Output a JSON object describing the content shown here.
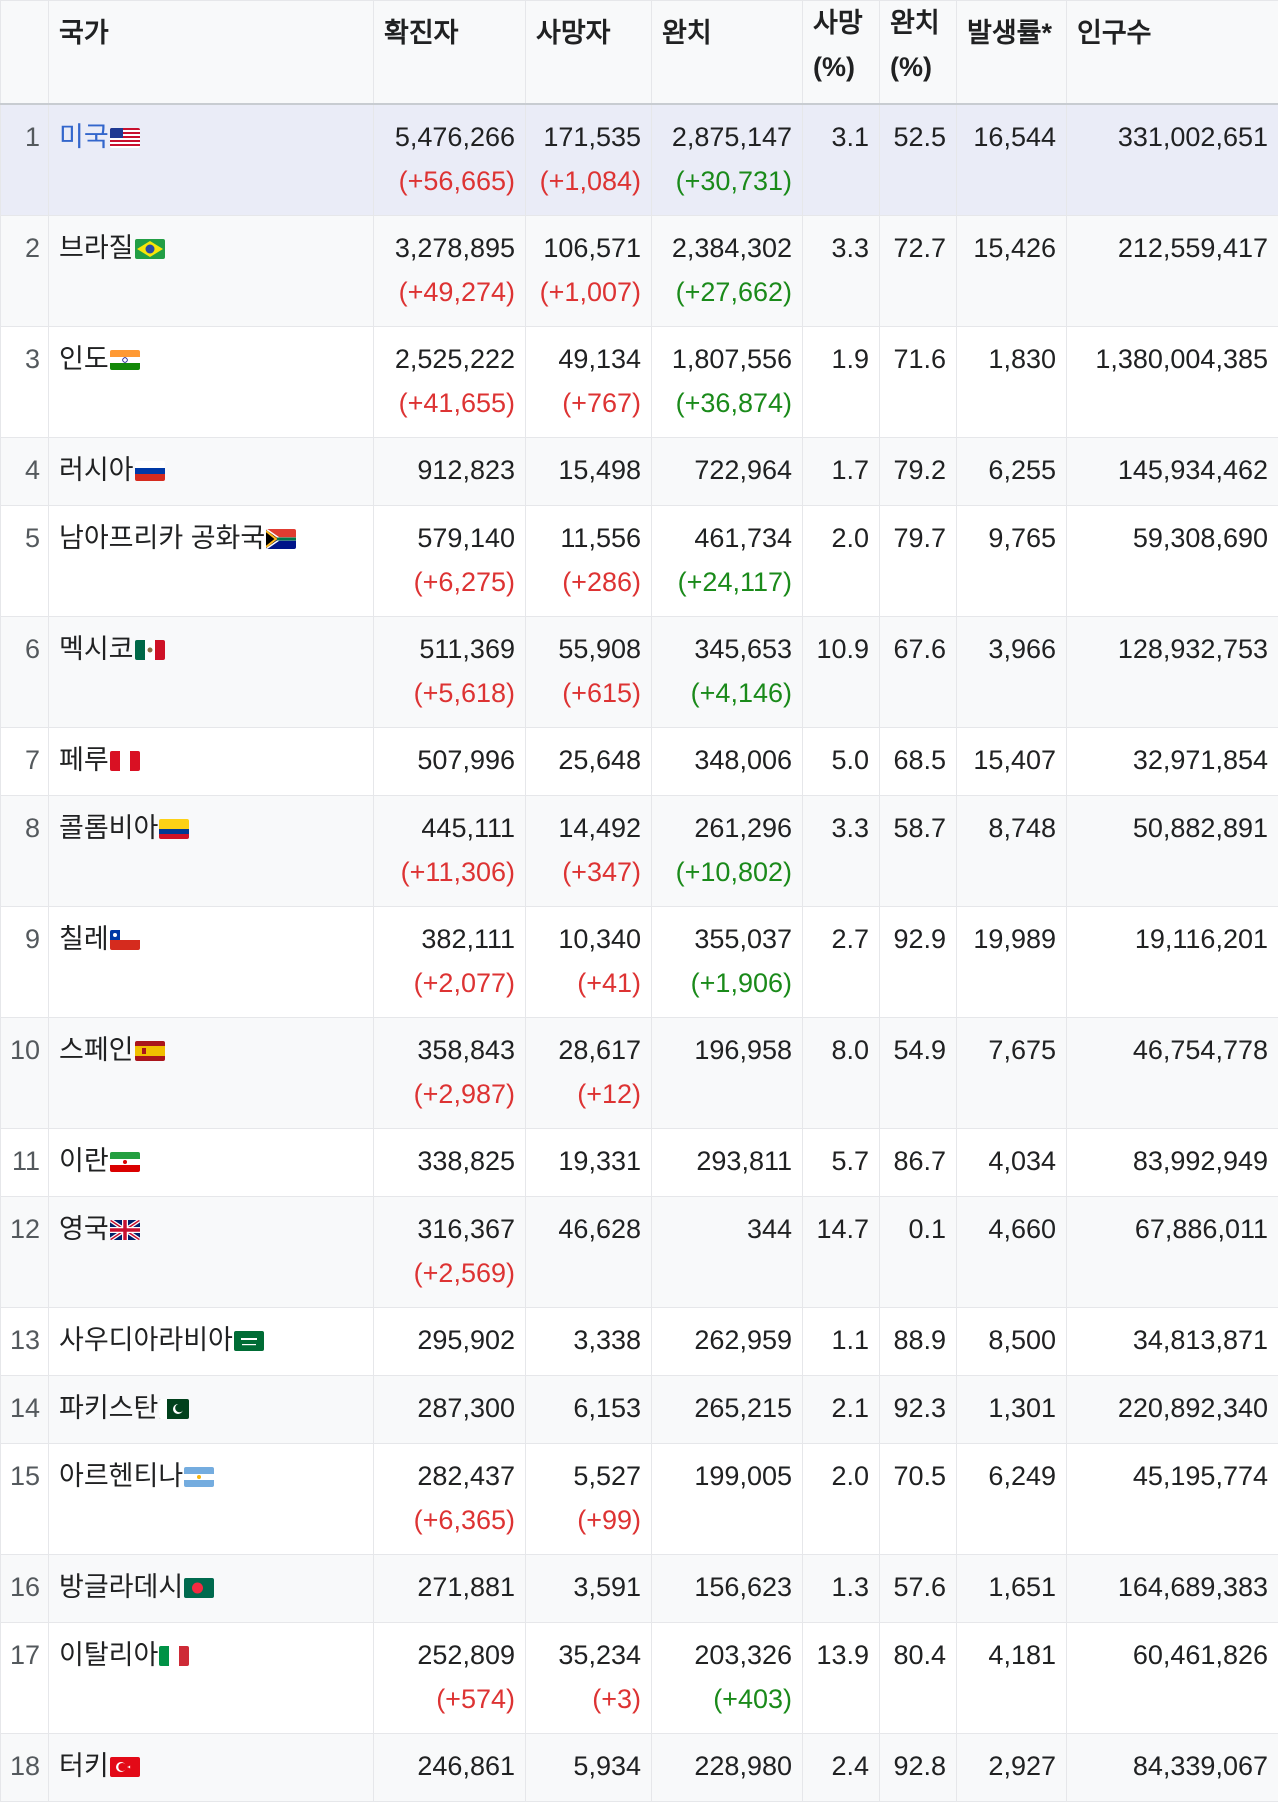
{
  "headers": {
    "rank": "",
    "country": "국가",
    "confirmed": "확진자",
    "deaths": "사망자",
    "recovered": "완치",
    "death_rate_1": "사망",
    "death_rate_2": "(%)",
    "recovery_rate_1": "완치",
    "recovery_rate_2": "(%)",
    "incidence": "발생률*",
    "population": "인구수"
  },
  "rows": [
    {
      "rank": "1",
      "country": "미국",
      "flag": "us-flag-icon",
      "confirmed": "5,476,266",
      "confirmed_delta": "(+56,665)",
      "deaths": "171,535",
      "deaths_delta": "(+1,084)",
      "recovered": "2,875,147",
      "recovered_delta": "(+30,731)",
      "death_rate": "3.1",
      "recovery_rate": "52.5",
      "incidence": "16,544",
      "population": "331,002,651"
    },
    {
      "rank": "2",
      "country": "브라질",
      "flag": "brazil-flag-icon",
      "confirmed": "3,278,895",
      "confirmed_delta": "(+49,274)",
      "deaths": "106,571",
      "deaths_delta": "(+1,007)",
      "recovered": "2,384,302",
      "recovered_delta": "(+27,662)",
      "death_rate": "3.3",
      "recovery_rate": "72.7",
      "incidence": "15,426",
      "population": "212,559,417"
    },
    {
      "rank": "3",
      "country": "인도",
      "flag": "india-flag-icon",
      "confirmed": "2,525,222",
      "confirmed_delta": "(+41,655)",
      "deaths": "49,134",
      "deaths_delta": "(+767)",
      "recovered": "1,807,556",
      "recovered_delta": "(+36,874)",
      "death_rate": "1.9",
      "recovery_rate": "71.6",
      "incidence": "1,830",
      "population": "1,380,004,385"
    },
    {
      "rank": "4",
      "country": "러시아",
      "flag": "russia-flag-icon",
      "confirmed": "912,823",
      "confirmed_delta": "",
      "deaths": "15,498",
      "deaths_delta": "",
      "recovered": "722,964",
      "recovered_delta": "",
      "death_rate": "1.7",
      "recovery_rate": "79.2",
      "incidence": "6,255",
      "population": "145,934,462"
    },
    {
      "rank": "5",
      "country": "남아프리카 공화국",
      "flag": "south-africa-flag-icon",
      "confirmed": "579,140",
      "confirmed_delta": "(+6,275)",
      "deaths": "11,556",
      "deaths_delta": "(+286)",
      "recovered": "461,734",
      "recovered_delta": "(+24,117)",
      "death_rate": "2.0",
      "recovery_rate": "79.7",
      "incidence": "9,765",
      "population": "59,308,690"
    },
    {
      "rank": "6",
      "country": "멕시코",
      "flag": "mexico-flag-icon",
      "confirmed": "511,369",
      "confirmed_delta": "(+5,618)",
      "deaths": "55,908",
      "deaths_delta": "(+615)",
      "recovered": "345,653",
      "recovered_delta": "(+4,146)",
      "death_rate": "10.9",
      "recovery_rate": "67.6",
      "incidence": "3,966",
      "population": "128,932,753"
    },
    {
      "rank": "7",
      "country": "페루",
      "flag": "peru-flag-icon",
      "confirmed": "507,996",
      "confirmed_delta": "",
      "deaths": "25,648",
      "deaths_delta": "",
      "recovered": "348,006",
      "recovered_delta": "",
      "death_rate": "5.0",
      "recovery_rate": "68.5",
      "incidence": "15,407",
      "population": "32,971,854"
    },
    {
      "rank": "8",
      "country": "콜롬비아",
      "flag": "colombia-flag-icon",
      "confirmed": "445,111",
      "confirmed_delta": "(+11,306)",
      "deaths": "14,492",
      "deaths_delta": "(+347)",
      "recovered": "261,296",
      "recovered_delta": "(+10,802)",
      "death_rate": "3.3",
      "recovery_rate": "58.7",
      "incidence": "8,748",
      "population": "50,882,891"
    },
    {
      "rank": "9",
      "country": "칠레",
      "flag": "chile-flag-icon",
      "confirmed": "382,111",
      "confirmed_delta": "(+2,077)",
      "deaths": "10,340",
      "deaths_delta": "(+41)",
      "recovered": "355,037",
      "recovered_delta": "(+1,906)",
      "death_rate": "2.7",
      "recovery_rate": "92.9",
      "incidence": "19,989",
      "population": "19,116,201"
    },
    {
      "rank": "10",
      "country": "스페인",
      "flag": "spain-flag-icon",
      "confirmed": "358,843",
      "confirmed_delta": "(+2,987)",
      "deaths": "28,617",
      "deaths_delta": "(+12)",
      "recovered": "196,958",
      "recovered_delta": "",
      "death_rate": "8.0",
      "recovery_rate": "54.9",
      "incidence": "7,675",
      "population": "46,754,778"
    },
    {
      "rank": "11",
      "country": "이란",
      "flag": "iran-flag-icon",
      "confirmed": "338,825",
      "confirmed_delta": "",
      "deaths": "19,331",
      "deaths_delta": "",
      "recovered": "293,811",
      "recovered_delta": "",
      "death_rate": "5.7",
      "recovery_rate": "86.7",
      "incidence": "4,034",
      "population": "83,992,949"
    },
    {
      "rank": "12",
      "country": "영국",
      "flag": "uk-flag-icon",
      "confirmed": "316,367",
      "confirmed_delta": "(+2,569)",
      "deaths": "46,628",
      "deaths_delta": "",
      "recovered": "344",
      "recovered_delta": "",
      "death_rate": "14.7",
      "recovery_rate": "0.1",
      "incidence": "4,660",
      "population": "67,886,011"
    },
    {
      "rank": "13",
      "country": "사우디아라비아",
      "flag": "saudi-arabia-flag-icon",
      "confirmed": "295,902",
      "confirmed_delta": "",
      "deaths": "3,338",
      "deaths_delta": "",
      "recovered": "262,959",
      "recovered_delta": "",
      "death_rate": "1.1",
      "recovery_rate": "88.9",
      "incidence": "8,500",
      "population": "34,813,871"
    },
    {
      "rank": "14",
      "country": "파키스탄",
      "flag": "pakistan-flag-icon",
      "confirmed": "287,300",
      "confirmed_delta": "",
      "deaths": "6,153",
      "deaths_delta": "",
      "recovered": "265,215",
      "recovered_delta": "",
      "death_rate": "2.1",
      "recovery_rate": "92.3",
      "incidence": "1,301",
      "population": "220,892,340"
    },
    {
      "rank": "15",
      "country": "아르헨티나",
      "flag": "argentina-flag-icon",
      "confirmed": "282,437",
      "confirmed_delta": "(+6,365)",
      "deaths": "5,527",
      "deaths_delta": "(+99)",
      "recovered": "199,005",
      "recovered_delta": "",
      "death_rate": "2.0",
      "recovery_rate": "70.5",
      "incidence": "6,249",
      "population": "45,195,774"
    },
    {
      "rank": "16",
      "country": "방글라데시",
      "flag": "bangladesh-flag-icon",
      "confirmed": "271,881",
      "confirmed_delta": "",
      "deaths": "3,591",
      "deaths_delta": "",
      "recovered": "156,623",
      "recovered_delta": "",
      "death_rate": "1.3",
      "recovery_rate": "57.6",
      "incidence": "1,651",
      "population": "164,689,383"
    },
    {
      "rank": "17",
      "country": "이탈리아",
      "flag": "italy-flag-icon",
      "confirmed": "252,809",
      "confirmed_delta": "(+574)",
      "deaths": "35,234",
      "deaths_delta": "(+3)",
      "recovered": "203,326",
      "recovered_delta": "(+403)",
      "death_rate": "13.9",
      "recovery_rate": "80.4",
      "incidence": "4,181",
      "population": "60,461,826"
    },
    {
      "rank": "18",
      "country": "터키",
      "flag": "turkey-flag-icon",
      "confirmed": "246,861",
      "confirmed_delta": "",
      "deaths": "5,934",
      "deaths_delta": "",
      "recovered": "228,980",
      "recovered_delta": "",
      "death_rate": "2.4",
      "recovery_rate": "92.8",
      "incidence": "2,927",
      "population": "84,339,067"
    }
  ]
}
